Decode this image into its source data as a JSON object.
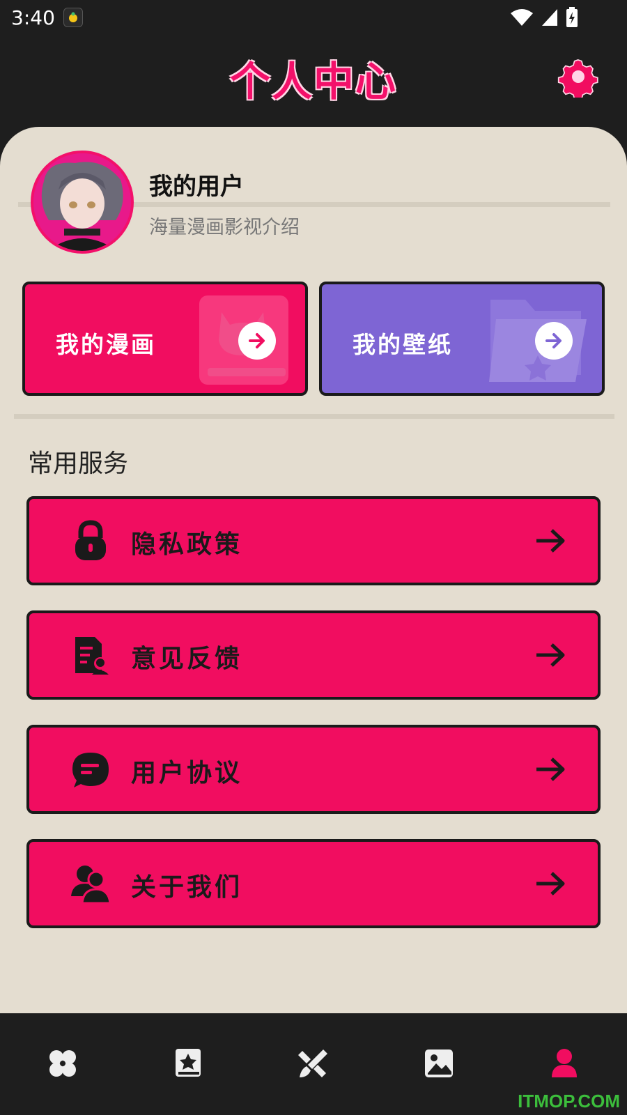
{
  "status_bar": {
    "time": "3:40"
  },
  "header": {
    "title": "个人中心"
  },
  "profile": {
    "name": "我的用户",
    "subtitle": "海量漫画影视介绍"
  },
  "feature_cards": [
    {
      "label": "我的漫画",
      "color": "#f10d60"
    },
    {
      "label": "我的壁纸",
      "color": "#7e65d4"
    }
  ],
  "services": {
    "title": "常用服务",
    "items": [
      {
        "label": "隐私政策",
        "icon": "lock-icon"
      },
      {
        "label": "意见反馈",
        "icon": "feedback-icon"
      },
      {
        "label": "用户协议",
        "icon": "chat-icon"
      },
      {
        "label": "关于我们",
        "icon": "users-icon"
      }
    ]
  },
  "bottom_nav": {
    "items": [
      {
        "icon": "clover-icon",
        "active": false
      },
      {
        "icon": "book-star-icon",
        "active": false
      },
      {
        "icon": "brush-icon",
        "active": false
      },
      {
        "icon": "image-icon",
        "active": false
      },
      {
        "icon": "person-icon",
        "active": true
      }
    ]
  },
  "watermark": "ITMOP.COM",
  "colors": {
    "accent": "#f10d60",
    "purple": "#7e65d4",
    "panel": "#e4ddd0",
    "dark": "#1e1e1e"
  }
}
